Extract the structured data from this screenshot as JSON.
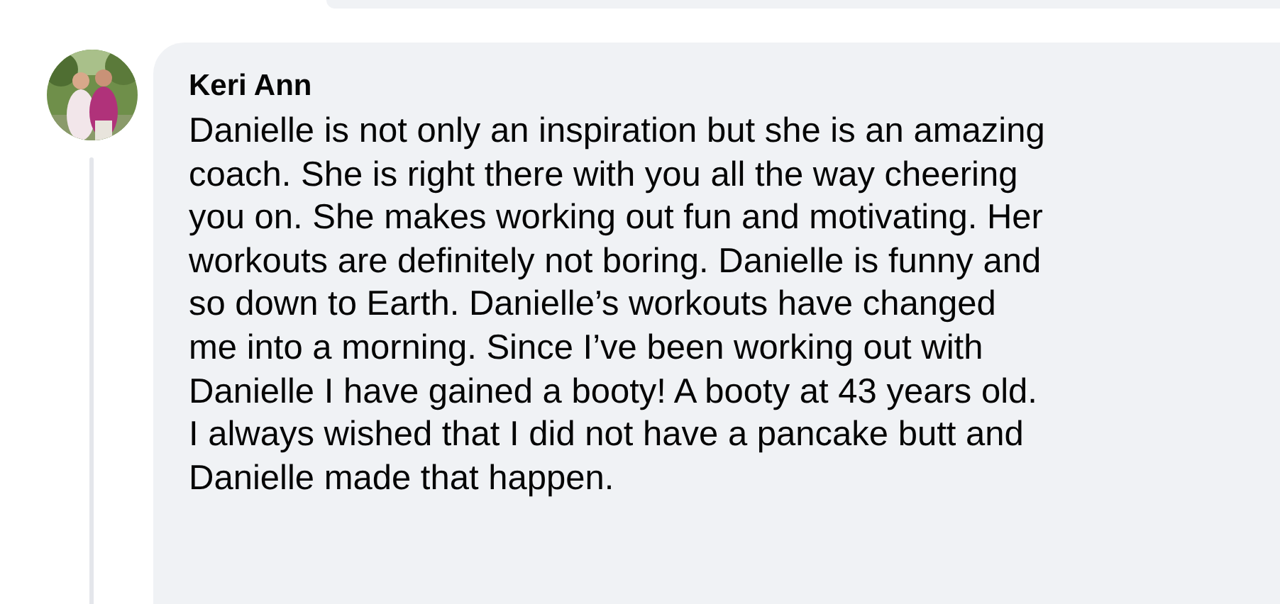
{
  "previous_comment": {
    "kind": "bubble"
  },
  "comment": {
    "author": "Keri Ann",
    "lines": [
      "Danielle is not only an inspiration but she is an amazing",
      "coach. She is right there with you all the way cheering",
      "you on. She makes working out fun and motivating. Her",
      "workouts are definitely not boring. Danielle is funny and",
      "so down to Earth. Danielle’s workouts have changed",
      "me into a morning. Since I’ve been working out with",
      "Danielle I have gained a booty! A booty at 43 years old.",
      "I always wished that I did not have a pancake butt and",
      "Danielle made that happen."
    ]
  }
}
